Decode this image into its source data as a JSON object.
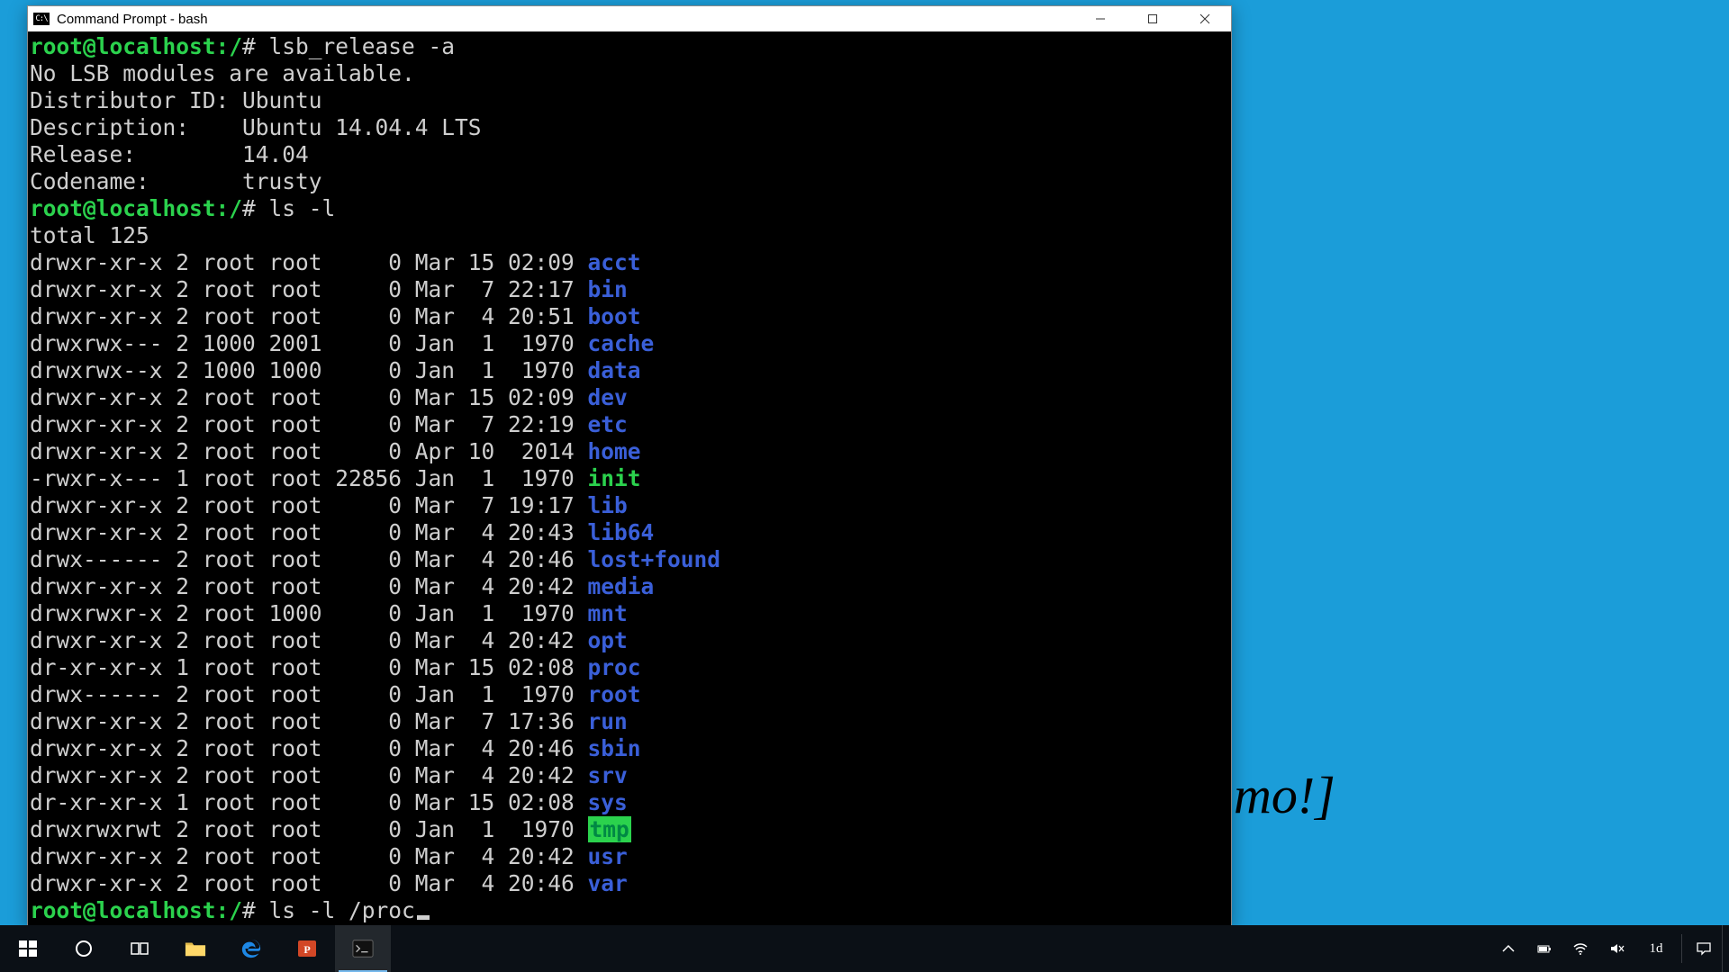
{
  "window": {
    "title": "Command Prompt - bash",
    "icon_text": "C:\\"
  },
  "terminal": {
    "prompt": "root@localhost:/",
    "hash": "#",
    "cmd1": "lsb_release -a",
    "lsb_out": [
      "No LSB modules are available.",
      "Distributor ID: Ubuntu",
      "Description:    Ubuntu 14.04.4 LTS",
      "Release:        14.04",
      "Codename:       trusty"
    ],
    "cmd2": "ls -l",
    "total_line": "total 125",
    "entries": [
      {
        "perm": "drwxr-xr-x",
        "links": "2",
        "owner": "root",
        "group": "root",
        "size": "0",
        "date": "Mar 15 02:09",
        "name": "acct",
        "kind": "dir"
      },
      {
        "perm": "drwxr-xr-x",
        "links": "2",
        "owner": "root",
        "group": "root",
        "size": "0",
        "date": "Mar  7 22:17",
        "name": "bin",
        "kind": "dir"
      },
      {
        "perm": "drwxr-xr-x",
        "links": "2",
        "owner": "root",
        "group": "root",
        "size": "0",
        "date": "Mar  4 20:51",
        "name": "boot",
        "kind": "dir"
      },
      {
        "perm": "drwxrwx---",
        "links": "2",
        "owner": "1000",
        "group": "2001",
        "size": "0",
        "date": "Jan  1  1970",
        "name": "cache",
        "kind": "dir"
      },
      {
        "perm": "drwxrwx--x",
        "links": "2",
        "owner": "1000",
        "group": "1000",
        "size": "0",
        "date": "Jan  1  1970",
        "name": "data",
        "kind": "dir"
      },
      {
        "perm": "drwxr-xr-x",
        "links": "2",
        "owner": "root",
        "group": "root",
        "size": "0",
        "date": "Mar 15 02:09",
        "name": "dev",
        "kind": "dir"
      },
      {
        "perm": "drwxr-xr-x",
        "links": "2",
        "owner": "root",
        "group": "root",
        "size": "0",
        "date": "Mar  7 22:19",
        "name": "etc",
        "kind": "dir"
      },
      {
        "perm": "drwxr-xr-x",
        "links": "2",
        "owner": "root",
        "group": "root",
        "size": "0",
        "date": "Apr 10  2014",
        "name": "home",
        "kind": "dir"
      },
      {
        "perm": "-rwxr-x---",
        "links": "1",
        "owner": "root",
        "group": "root",
        "size": "22856",
        "date": "Jan  1  1970",
        "name": "init",
        "kind": "exec"
      },
      {
        "perm": "drwxr-xr-x",
        "links": "2",
        "owner": "root",
        "group": "root",
        "size": "0",
        "date": "Mar  7 19:17",
        "name": "lib",
        "kind": "dir"
      },
      {
        "perm": "drwxr-xr-x",
        "links": "2",
        "owner": "root",
        "group": "root",
        "size": "0",
        "date": "Mar  4 20:43",
        "name": "lib64",
        "kind": "dir"
      },
      {
        "perm": "drwx------",
        "links": "2",
        "owner": "root",
        "group": "root",
        "size": "0",
        "date": "Mar  4 20:46",
        "name": "lost+found",
        "kind": "dir"
      },
      {
        "perm": "drwxr-xr-x",
        "links": "2",
        "owner": "root",
        "group": "root",
        "size": "0",
        "date": "Mar  4 20:42",
        "name": "media",
        "kind": "dir"
      },
      {
        "perm": "drwxrwxr-x",
        "links": "2",
        "owner": "root",
        "group": "1000",
        "size": "0",
        "date": "Jan  1  1970",
        "name": "mnt",
        "kind": "dir"
      },
      {
        "perm": "drwxr-xr-x",
        "links": "2",
        "owner": "root",
        "group": "root",
        "size": "0",
        "date": "Mar  4 20:42",
        "name": "opt",
        "kind": "dir"
      },
      {
        "perm": "dr-xr-xr-x",
        "links": "1",
        "owner": "root",
        "group": "root",
        "size": "0",
        "date": "Mar 15 02:08",
        "name": "proc",
        "kind": "dir"
      },
      {
        "perm": "drwx------",
        "links": "2",
        "owner": "root",
        "group": "root",
        "size": "0",
        "date": "Jan  1  1970",
        "name": "root",
        "kind": "dir"
      },
      {
        "perm": "drwxr-xr-x",
        "links": "2",
        "owner": "root",
        "group": "root",
        "size": "0",
        "date": "Mar  7 17:36",
        "name": "run",
        "kind": "dir"
      },
      {
        "perm": "drwxr-xr-x",
        "links": "2",
        "owner": "root",
        "group": "root",
        "size": "0",
        "date": "Mar  4 20:46",
        "name": "sbin",
        "kind": "dir"
      },
      {
        "perm": "drwxr-xr-x",
        "links": "2",
        "owner": "root",
        "group": "root",
        "size": "0",
        "date": "Mar  4 20:42",
        "name": "srv",
        "kind": "dir"
      },
      {
        "perm": "dr-xr-xr-x",
        "links": "1",
        "owner": "root",
        "group": "root",
        "size": "0",
        "date": "Mar 15 02:08",
        "name": "sys",
        "kind": "dir"
      },
      {
        "perm": "drwxrwxrwt",
        "links": "2",
        "owner": "root",
        "group": "root",
        "size": "0",
        "date": "Jan  1  1970",
        "name": "tmp",
        "kind": "tmp"
      },
      {
        "perm": "drwxr-xr-x",
        "links": "2",
        "owner": "root",
        "group": "root",
        "size": "0",
        "date": "Mar  4 20:42",
        "name": "usr",
        "kind": "dir"
      },
      {
        "perm": "drwxr-xr-x",
        "links": "2",
        "owner": "root",
        "group": "root",
        "size": "0",
        "date": "Mar  4 20:46",
        "name": "var",
        "kind": "dir"
      }
    ],
    "cmd3": "ls -l /proc"
  },
  "background_text": "mo!]",
  "tray_label": "1d"
}
